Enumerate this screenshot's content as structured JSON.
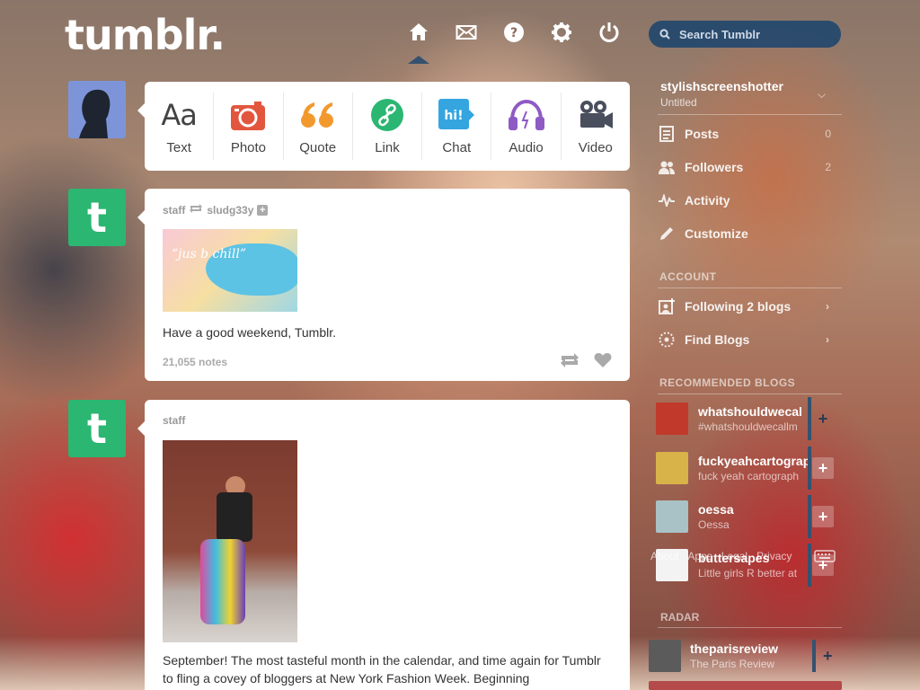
{
  "header": {
    "logo": "tumblr.",
    "nav": [
      {
        "name": "home",
        "icon": "home-icon"
      },
      {
        "name": "inbox",
        "icon": "envelope-icon"
      },
      {
        "name": "help",
        "icon": "help-icon"
      },
      {
        "name": "settings",
        "icon": "gear-icon"
      },
      {
        "name": "logout",
        "icon": "power-icon"
      }
    ],
    "search_placeholder": "Search Tumblr"
  },
  "composer": {
    "types": [
      {
        "label": "Text",
        "icon": "text-icon",
        "glyph": "Aa"
      },
      {
        "label": "Photo",
        "icon": "camera-icon"
      },
      {
        "label": "Quote",
        "icon": "quote-icon",
        "glyph": "“"
      },
      {
        "label": "Link",
        "icon": "link-icon"
      },
      {
        "label": "Chat",
        "icon": "chat-icon",
        "glyph": "hi!"
      },
      {
        "label": "Audio",
        "icon": "headphones-icon"
      },
      {
        "label": "Video",
        "icon": "video-camera-icon"
      }
    ],
    "colors": {
      "text": "#444444",
      "photo": "#e3563e",
      "quote": "#f2992e",
      "link": "#2bb672",
      "chat": "#35a5e0",
      "audio": "#8e5bc4",
      "video": "#4a4f5e"
    }
  },
  "posts": [
    {
      "author": "staff",
      "reblogged_from": "sludg33y",
      "image_caption": "“jus b chill”",
      "text": "Have a good weekend, Tumblr.",
      "notes": "21,055 notes"
    },
    {
      "author": "staff",
      "text": "September! The most tasteful month in the calendar, and time again for Tumblr to fling a covey of bloggers at New York Fashion Week. Beginning"
    }
  ],
  "sidebar": {
    "blog_name": "stylishscreenshotter",
    "blog_sub": "Untitled",
    "rows": [
      {
        "label": "Posts",
        "count": "0",
        "icon": "posts-icon"
      },
      {
        "label": "Followers",
        "count": "2",
        "icon": "followers-icon"
      },
      {
        "label": "Activity",
        "count": "",
        "icon": "activity-icon"
      },
      {
        "label": "Customize",
        "count": "",
        "icon": "customize-icon"
      }
    ],
    "account_label": "ACCOUNT",
    "account_rows": [
      {
        "label": "Following 2 blogs",
        "icon": "following-icon"
      },
      {
        "label": "Find Blogs",
        "icon": "find-blogs-icon"
      }
    ],
    "recommended_label": "RECOMMENDED BLOGS",
    "recommended": [
      {
        "name": "whatshouldwecal",
        "sub": "#whatshouldwecallm",
        "thumb_color": "#c0392b"
      },
      {
        "name": "fuckyeahcartograp",
        "sub": "fuck yeah cartograph",
        "thumb_color": "#d8b34a"
      },
      {
        "name": "oessa",
        "sub": "Oessa",
        "thumb_color": "#a9c2c6"
      },
      {
        "name": "buttersapes",
        "sub": "Little girls R better at",
        "thumb_color": "#f3f3f3"
      }
    ],
    "footer_links": [
      "About",
      "Apps",
      "Legal",
      "Privacy"
    ],
    "radar_label": "RADAR",
    "radar": {
      "name": "theparisreview",
      "sub": "The Paris Review"
    }
  }
}
